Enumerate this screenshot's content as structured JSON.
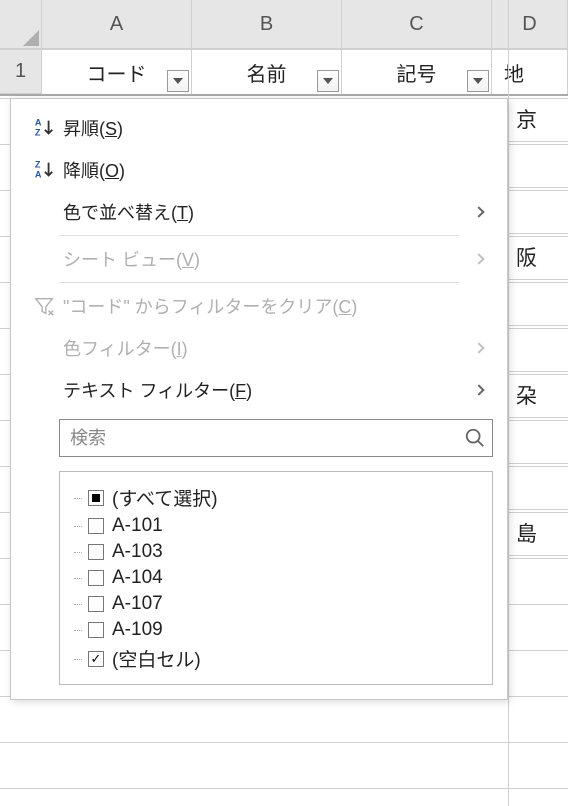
{
  "columns": [
    "A",
    "B",
    "C",
    "D"
  ],
  "row_number": "1",
  "header_cells": [
    "コード",
    "名前",
    "記号",
    "地"
  ],
  "right_column_cells": [
    "京",
    "",
    " ",
    "阪",
    "",
    " ",
    "朶",
    "",
    " ",
    "島"
  ],
  "menu": {
    "sort_asc": "昇順(S)",
    "sort_desc": "降順(O)",
    "sort_by_color": "色で並べ替え(T)",
    "sheet_view": "シート ビュー(V)",
    "clear_filter": "\"コード\" からフィルターをクリア(C)",
    "color_filter": "色フィルター(I)",
    "text_filter": "テキスト フィルター(F)"
  },
  "search": {
    "placeholder": "検索"
  },
  "checklist": [
    {
      "state": "indeterminate",
      "label": "(すべて選択)"
    },
    {
      "state": "unchecked",
      "label": "A-101"
    },
    {
      "state": "unchecked",
      "label": "A-103"
    },
    {
      "state": "unchecked",
      "label": "A-104"
    },
    {
      "state": "unchecked",
      "label": "A-107"
    },
    {
      "state": "unchecked",
      "label": "A-109"
    },
    {
      "state": "checked",
      "label": "(空白セル)"
    }
  ]
}
